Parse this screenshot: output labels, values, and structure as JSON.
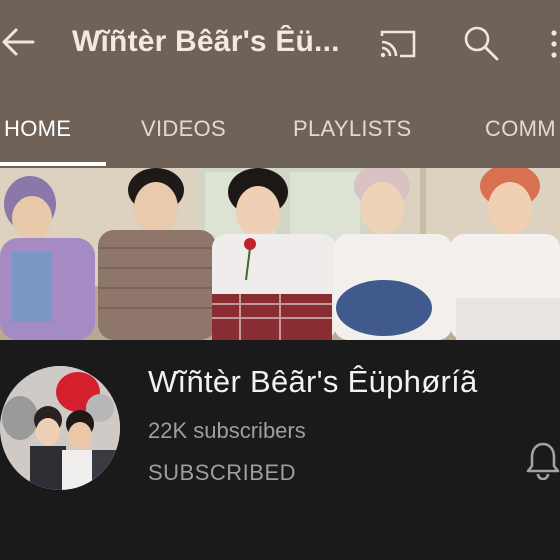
{
  "app_bar": {
    "title": "Wĩñtèr Bêãr's Êü...",
    "back_icon": "arrow-left-icon",
    "cast_icon": "cast-icon",
    "search_icon": "search-icon",
    "more_icon": "more-vertical-icon"
  },
  "tabs": [
    {
      "label": "HOME",
      "active": true
    },
    {
      "label": "VIDEOS",
      "active": false
    },
    {
      "label": "PLAYLISTS",
      "active": false
    },
    {
      "label": "COMM",
      "active": false
    }
  ],
  "channel": {
    "name": "Wĩñtèr Bêãr's Êüphøríã",
    "subscribers": "22K subscribers",
    "subscribe_state": "SUBSCRIBED",
    "bell_icon": "notification-bell-icon"
  },
  "colors": {
    "app_bar_bg": "#6e6259",
    "page_bg": "#1a1a1a",
    "tab_text": "#e4d9cf",
    "active_tab_underline": "#ffffff",
    "muted_text": "#9e9e9e"
  }
}
